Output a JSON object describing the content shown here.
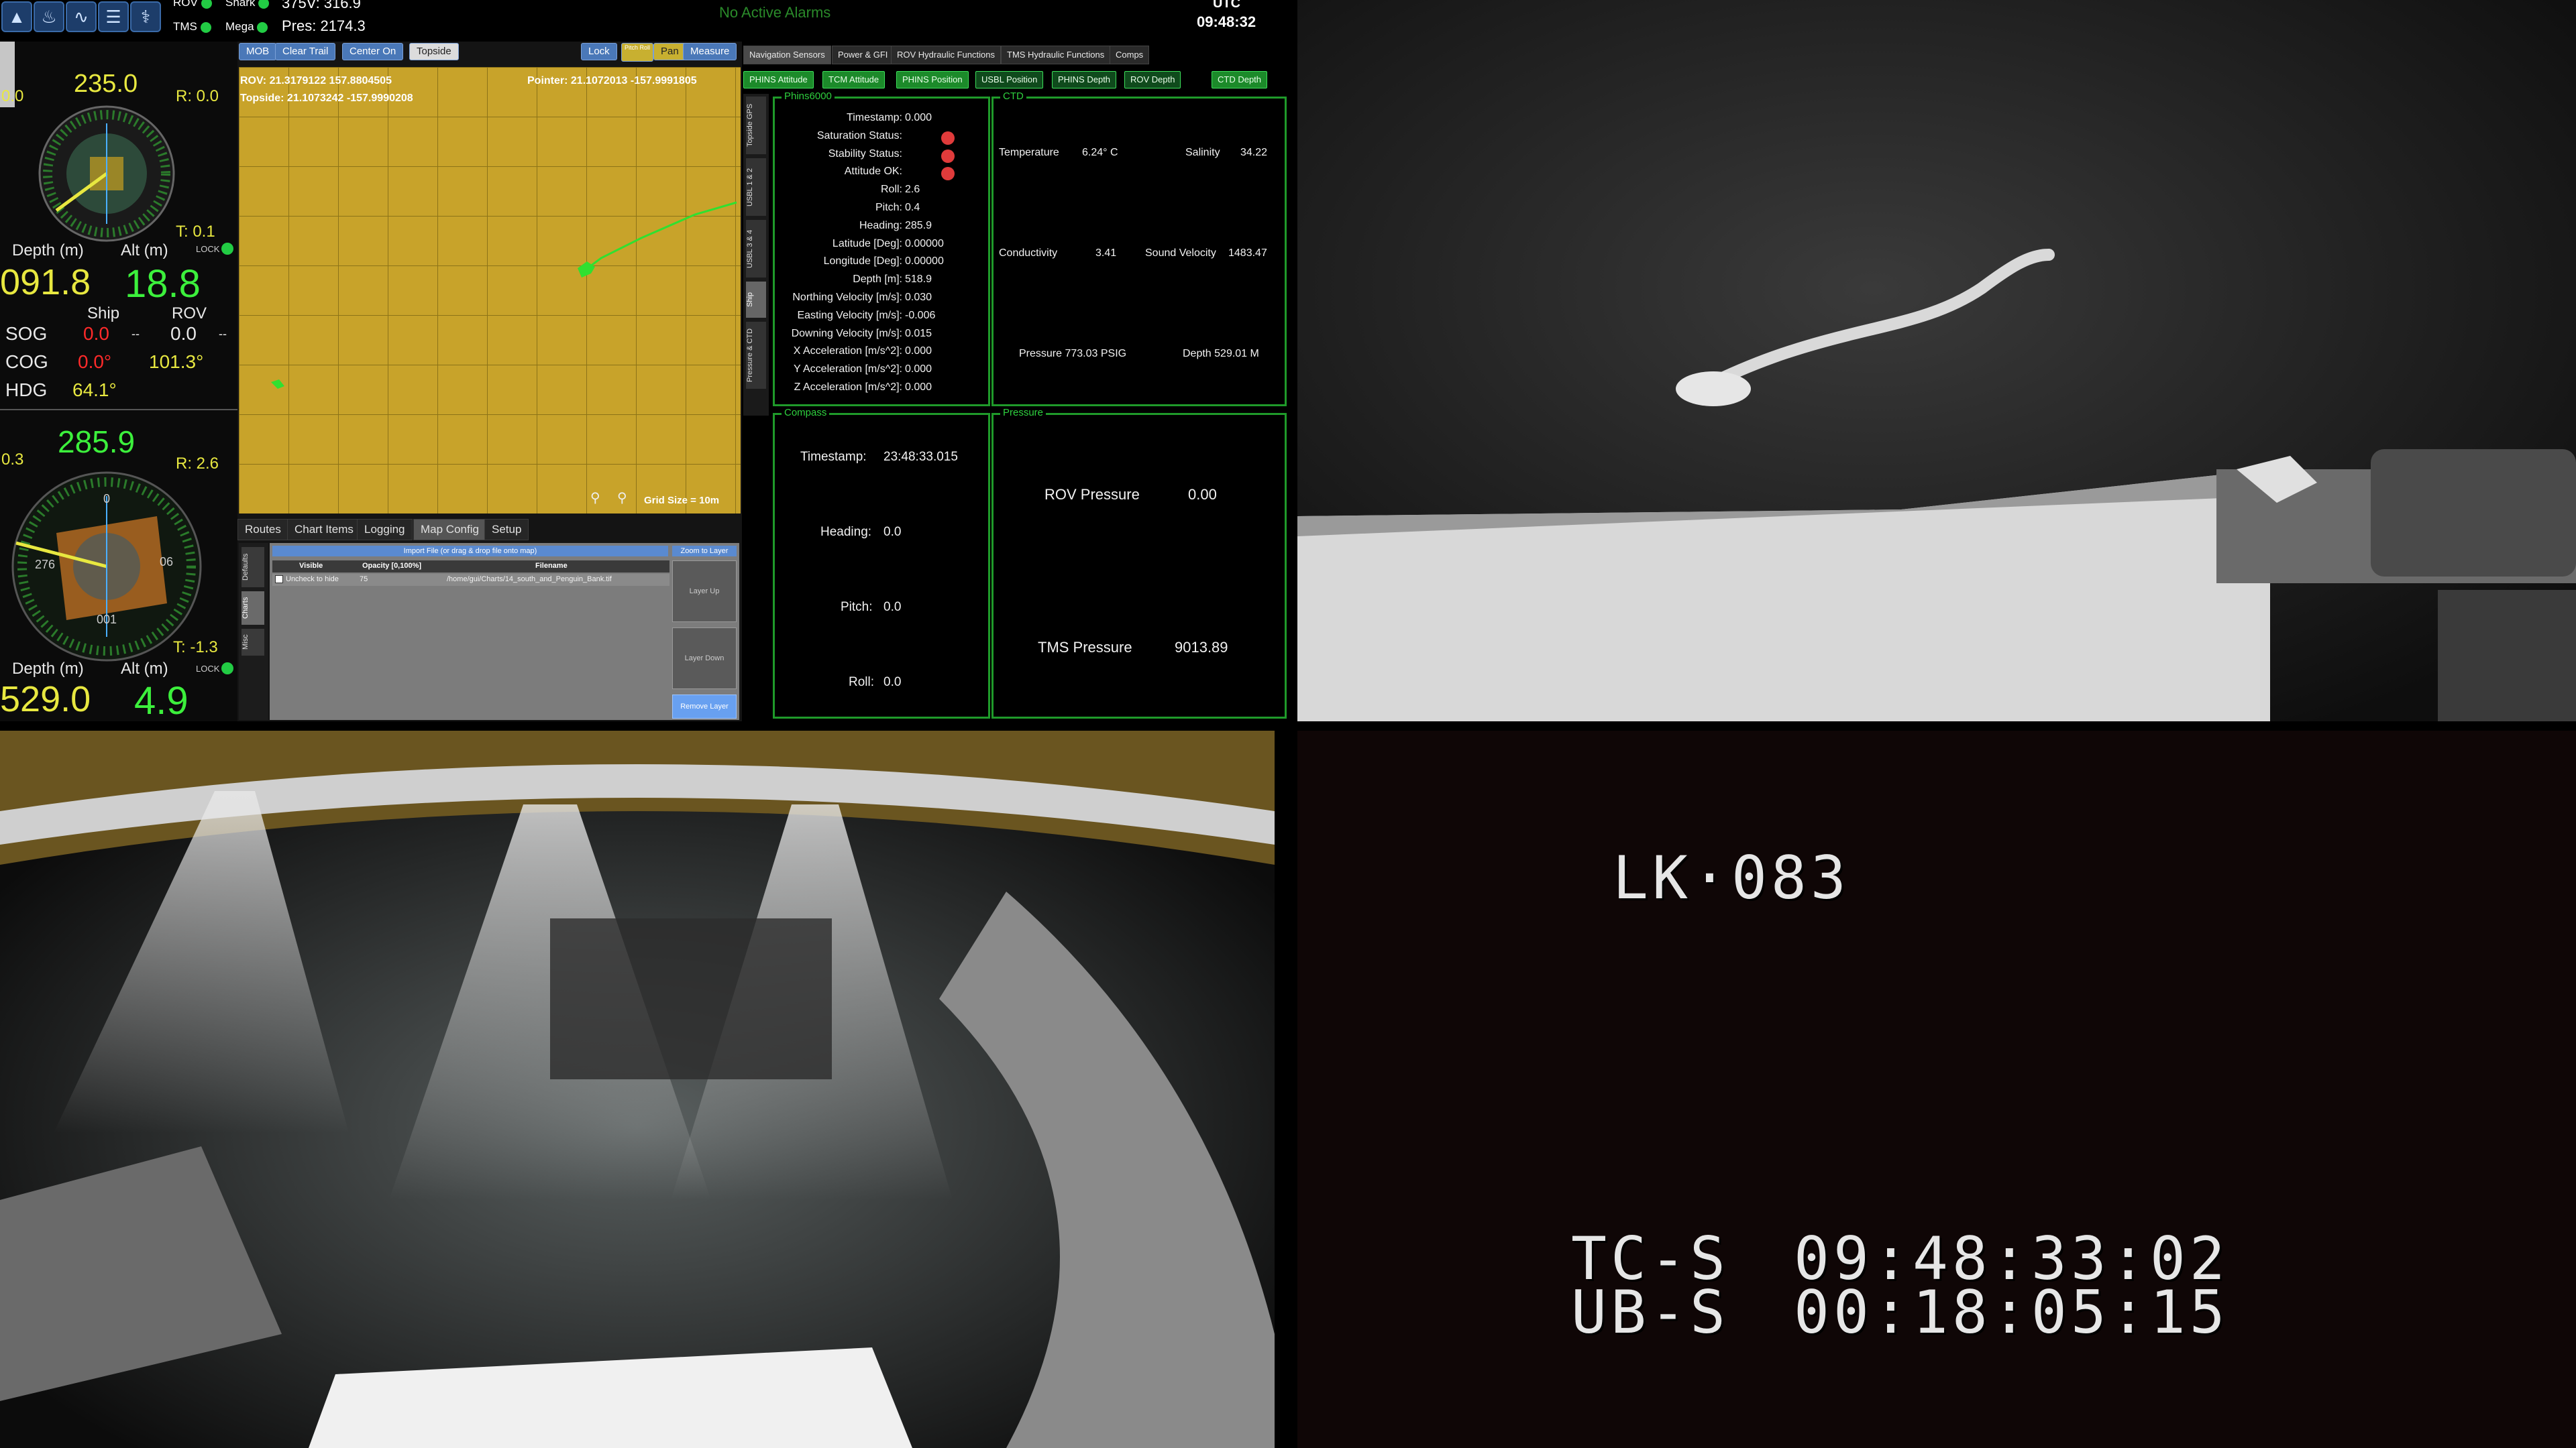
{
  "topbar": {
    "rov_label": "ROV",
    "tms_label": "TMS",
    "shark_label": "Shark",
    "mega_label": "Mega",
    "voltage": "375V: 316.9",
    "pres": "Pres: 2174.3",
    "alarms": "No Active Alarms",
    "utc_label": "UTC",
    "time": "09:48:32"
  },
  "ship_gauge": {
    "heading_value": "235.0",
    "l_value": "0.0",
    "r_value": "R: 0.0",
    "t_value": "T: 0.1",
    "lock": "LOCK",
    "depth_label": "Depth (m)",
    "alt_label": "Alt (m)",
    "depth": "091.8",
    "alt": "18.8"
  },
  "nav": {
    "ship_col": "Ship",
    "rov_col": "ROV",
    "rows": [
      {
        "label": "SOG",
        "ship": "0.0",
        "ship_unit": "--",
        "rov": "0.0",
        "rov_unit": "--"
      },
      {
        "label": "COG",
        "ship": "0.0°",
        "rov": "101.3°"
      },
      {
        "label": "HDG",
        "ship": "64.1°"
      }
    ]
  },
  "rov_gauge": {
    "heading_value": "285.9",
    "l_value": "0.3",
    "r_value": "R: 2.6",
    "t_value": "T: -1.3",
    "lock": "LOCK",
    "depth_label": "Depth (m)",
    "alt_label": "Alt (m)",
    "depth": "529.0",
    "alt": "4.9",
    "dial_labels": {
      "n": "0",
      "e": "06",
      "s": "001",
      "w": "276"
    }
  },
  "map": {
    "buttons": [
      "MOB",
      "Clear Trail",
      "Center On",
      "Topside",
      "Lock",
      "Pitch Roll",
      "Pan",
      "Measure"
    ],
    "rov_coords": "ROV: 21.3179122 157.8804505",
    "topside_coords": "Topside: 21.1073242 -157.9990208",
    "pointer_coords": "Pointer: 21.1072013 -157.9991805",
    "grid_size": "Grid Size = 10m",
    "bottom_tabs": [
      "Routes",
      "Chart Items",
      "Logging",
      "Map Config",
      "Setup"
    ],
    "side_tabs": [
      "Defaults",
      "Charts",
      "Misc"
    ],
    "import_bar": "Import File (or drag & drop file onto map)",
    "zoom_layer": "Zoom to Layer",
    "table_headers": [
      "Visible",
      "Opacity [0,100%]",
      "Filename"
    ],
    "table_row": {
      "visible": "Uncheck to hide",
      "opacity": "75",
      "filename": "/home/gui/Charts/14_south_and_Penguin_Bank.tif"
    },
    "layer_buttons": [
      "Layer Up",
      "Layer Down",
      "Remove Layer"
    ]
  },
  "sensors": {
    "nav_tabs": [
      "Navigation Sensors",
      "Power & GFI",
      "ROV Hydraulic Functions",
      "TMS Hydraulic Functions",
      "Comps"
    ],
    "green_tabs": [
      "PHINS Attitude",
      "TCM Attitude",
      "PHINS Position",
      "USBL Position",
      "PHINS Depth",
      "ROV Depth",
      "CTD Depth"
    ],
    "vert_tabs": [
      "Topside GPS",
      "USBL 1 & 2",
      "USBL 3 & 4",
      "Ship",
      "Pressure & CTD"
    ],
    "phins": {
      "title": "Phins6000",
      "rows": [
        {
          "label": "Timestamp:",
          "value": "0.000"
        },
        {
          "label": "Saturation Status:",
          "value": ""
        },
        {
          "label": "Stability Status:",
          "value": ""
        },
        {
          "label": "Attitude OK:",
          "value": ""
        },
        {
          "label": "Roll:",
          "value": "2.6"
        },
        {
          "label": "Pitch:",
          "value": "0.4"
        },
        {
          "label": "Heading:",
          "value": "285.9"
        },
        {
          "label": "Latitude [Deg]:",
          "value": "0.00000"
        },
        {
          "label": "Longitude [Deg]:",
          "value": "0.00000"
        },
        {
          "label": "Depth [m]:",
          "value": "518.9"
        },
        {
          "label": "Northing Velocity [m/s]:",
          "value": "0.030"
        },
        {
          "label": "Easting Velocity [m/s]:",
          "value": "-0.006"
        },
        {
          "label": "Downing Velocity [m/s]:",
          "value": "0.015"
        },
        {
          "label": "X Acceleration [m/s^2]:",
          "value": "0.000"
        },
        {
          "label": "Y Acceleration [m/s^2]:",
          "value": "0.000"
        },
        {
          "label": "Z Acceleration [m/s^2]:",
          "value": "0.000"
        }
      ]
    },
    "ctd": {
      "title": "CTD",
      "temperature_label": "Temperature",
      "temperature": "6.24° C",
      "salinity_label": "Salinity",
      "salinity": "34.22",
      "conductivity_label": "Conductivity",
      "conductivity": "3.41",
      "sound_label": "Sound Velocity",
      "sound": "1483.47",
      "pressure_text": "Pressure 773.03 PSIG",
      "depth_text": "Depth 529.01 M"
    },
    "compass": {
      "title": "Compass",
      "timestamp_label": "Timestamp:",
      "timestamp": "23:48:33.015",
      "heading_label": "Heading:",
      "heading": "0.0",
      "pitch_label": "Pitch:",
      "pitch": "0.0",
      "roll_label": "Roll:",
      "roll": "0.0"
    },
    "pressure": {
      "title": "Pressure",
      "rov_label": "ROV Pressure",
      "rov": "0.00",
      "tms_label": "TMS Pressure",
      "tms": "9013.89"
    }
  },
  "cam4": {
    "id": "LK·083",
    "tc_label": "TC-S",
    "tc": "09:48:33:02",
    "ub_label": "UB-S",
    "ub": "00:18:05:15"
  }
}
